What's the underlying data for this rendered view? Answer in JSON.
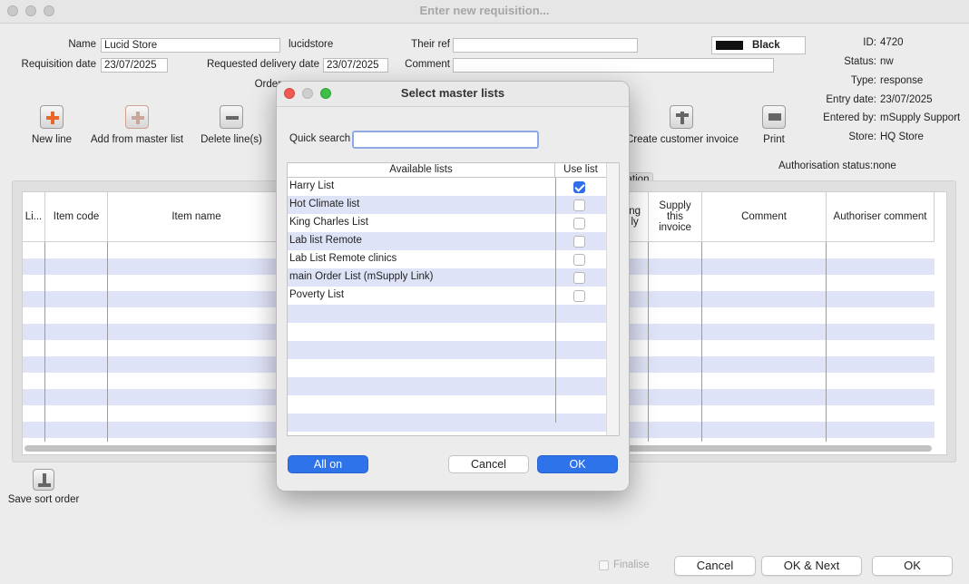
{
  "window": {
    "title": "Enter new requisition..."
  },
  "form": {
    "name_label": "Name",
    "name_value": "Lucid Store",
    "name_code": "lucidstore",
    "their_ref_label": "Their ref",
    "their_ref_value": "",
    "req_date_label": "Requisition date",
    "req_date_value": "23/07/2025",
    "delivery_label": "Requested delivery date",
    "delivery_value": "23/07/2025",
    "comment_label": "Comment",
    "comment_value": "",
    "order_label": "Order",
    "color_label": "Black",
    "color_swatch": "#111111"
  },
  "info": {
    "id_label": "ID:",
    "id_value": "4720",
    "status_label": "Status:",
    "status_value": "nw",
    "type_label": "Type:",
    "type_value": "response",
    "entry_label": "Entry date:",
    "entry_value": "23/07/2025",
    "entered_label": "Entered by:",
    "entered_value": "mSupply Support",
    "store_label": "Store:",
    "store_value": "HQ Store",
    "auth_status": "Authorisation status:none"
  },
  "toolbar": {
    "new_line": "New line",
    "add_master": "Add from master list",
    "delete_lines": "Delete line(s)",
    "create_invoice": "Create customer invoice",
    "print": "Print",
    "tab_partial": "ation"
  },
  "grid": {
    "headers": {
      "line": "Li...",
      "item_code": "Item code",
      "item_name": "Item name",
      "partial": "ng\nly",
      "supply": "Supply\nthis\ninvoice",
      "comment": "Comment",
      "auth_comment": "Authoriser comment"
    }
  },
  "bottom": {
    "save_sort": "Save sort order",
    "finalise": "Finalise",
    "cancel": "Cancel",
    "ok_next": "OK & Next",
    "ok": "OK"
  },
  "modal": {
    "title": "Select master lists",
    "quick_search_label": "Quick search",
    "quick_search_value": "",
    "col_available": "Available lists",
    "col_use": "Use list",
    "lists": [
      {
        "name": "Harry List",
        "use": true
      },
      {
        "name": "Hot Climate list",
        "use": false
      },
      {
        "name": "King Charles List",
        "use": false
      },
      {
        "name": "Lab list Remote",
        "use": false
      },
      {
        "name": "Lab List Remote clinics",
        "use": false
      },
      {
        "name": "main Order List (mSupply Link)",
        "use": false
      },
      {
        "name": "Poverty List",
        "use": false
      }
    ],
    "all_on": "All on",
    "cancel": "Cancel",
    "ok": "OK"
  },
  "colors": {
    "accent": "#2f73ea",
    "stripe": "#dfe3f7",
    "close": "#ee5b55",
    "minimize": "#cfcfcf",
    "zoom": "#3fbf46"
  }
}
